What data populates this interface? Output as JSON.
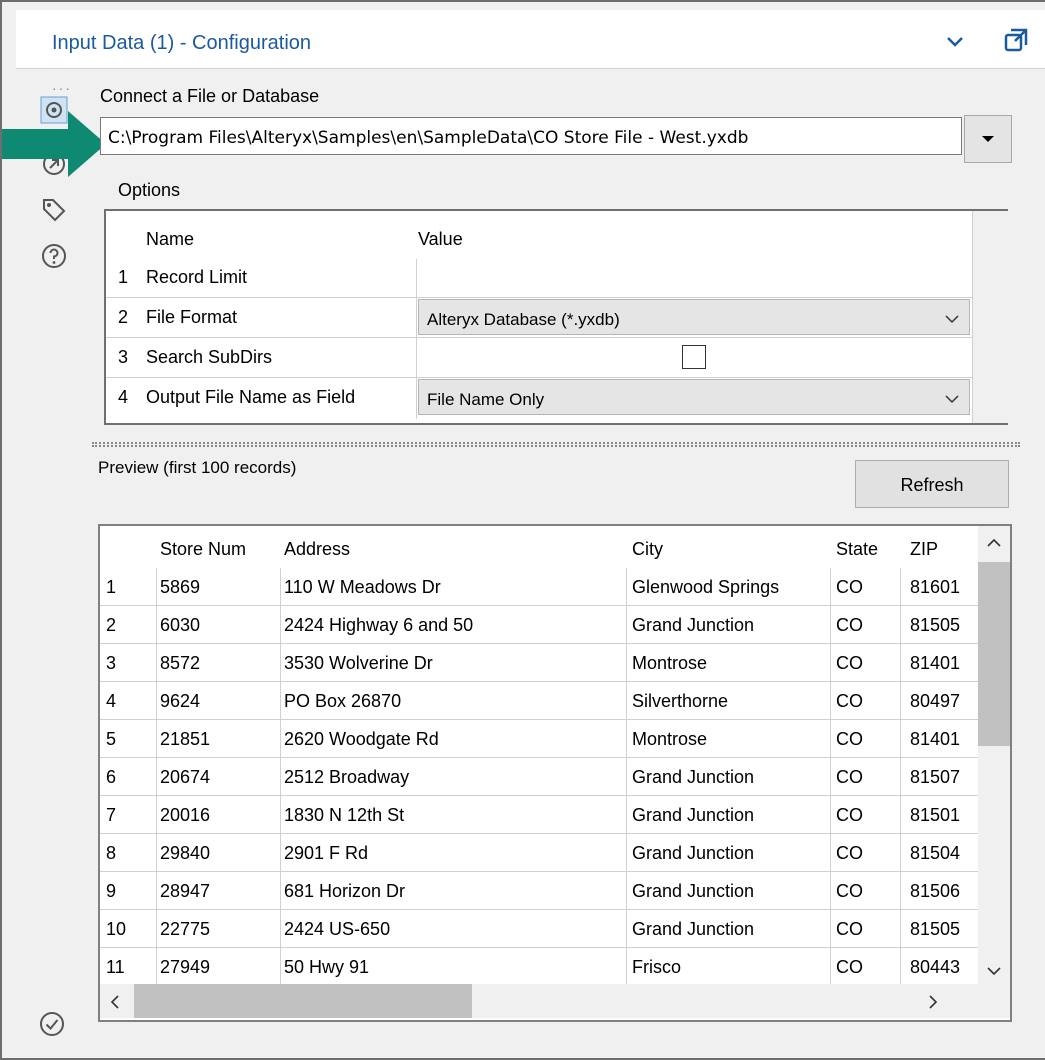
{
  "window": {
    "title": "Input Data (1) - Configuration",
    "left_icons": [
      "gear-icon",
      "connection-icon",
      "tag-icon",
      "help-icon"
    ],
    "bottom_icon": "checkmark-circle-icon"
  },
  "connect": {
    "label": "Connect a File or Database",
    "path": "C:\\Program Files\\Alteryx\\Samples\\en\\SampleData\\CO Store File - West.yxdb"
  },
  "options": {
    "label": "Options",
    "headers": {
      "name": "Name",
      "value": "Value"
    },
    "rows": [
      {
        "num": "1",
        "name": "Record Limit",
        "value": ""
      },
      {
        "num": "2",
        "name": "File Format",
        "value": "Alteryx Database (*.yxdb)"
      },
      {
        "num": "3",
        "name": "Search SubDirs",
        "value": ""
      },
      {
        "num": "4",
        "name": "Output File Name as Field",
        "value": "File Name Only"
      }
    ]
  },
  "preview": {
    "label": "Preview (first 100 records)",
    "refresh_label": "Refresh",
    "columns": [
      "",
      "Store Num",
      "Address",
      "City",
      "State",
      "ZIP"
    ],
    "rows": [
      [
        "1",
        "5869",
        "110 W Meadows Dr",
        "Glenwood Springs",
        "CO",
        "81601"
      ],
      [
        "2",
        "6030",
        "2424 Highway 6 and 50",
        "Grand Junction",
        "CO",
        "81505"
      ],
      [
        "3",
        "8572",
        "3530 Wolverine Dr",
        "Montrose",
        "CO",
        "81401"
      ],
      [
        "4",
        "9624",
        "PO Box 26870",
        "Silverthorne",
        "CO",
        "80497"
      ],
      [
        "5",
        "21851",
        "2620 Woodgate Rd",
        "Montrose",
        "CO",
        "81401"
      ],
      [
        "6",
        "20674",
        "2512 Broadway",
        "Grand Junction",
        "CO",
        "81507"
      ],
      [
        "7",
        "20016",
        "1830 N 12th St",
        "Grand Junction",
        "CO",
        "81501"
      ],
      [
        "8",
        "29840",
        "2901 F Rd",
        "Grand Junction",
        "CO",
        "81504"
      ],
      [
        "9",
        "28947",
        "681 Horizon Dr",
        "Grand Junction",
        "CO",
        "81506"
      ],
      [
        "10",
        "22775",
        "2424 US-650",
        "Grand Junction",
        "CO",
        "81505"
      ],
      [
        "11",
        "27949",
        "50 Hwy 91",
        "Frisco",
        "CO",
        "80443"
      ]
    ]
  },
  "colors": {
    "title": "#1a5a9e",
    "arrow": "#0f8a72",
    "scroll_thumb": "#c1c1c1"
  }
}
